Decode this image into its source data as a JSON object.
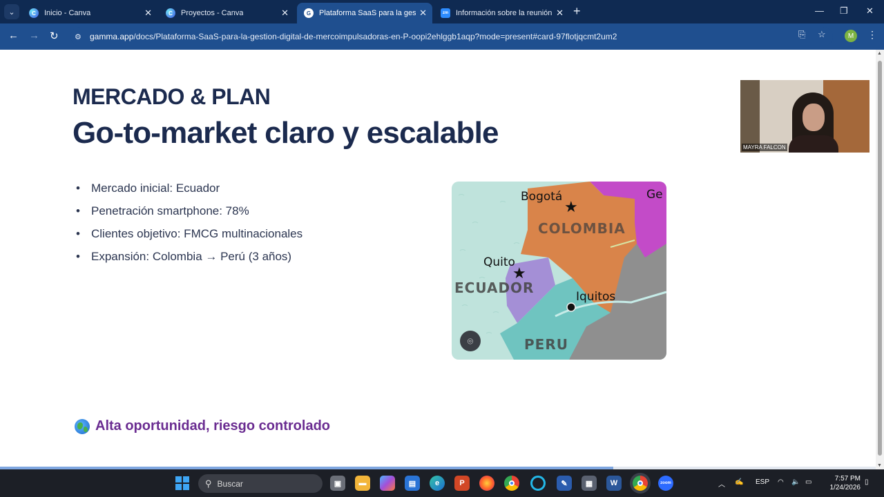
{
  "browser": {
    "tabs": [
      {
        "title": "Inicio - Canva",
        "icon": "canva-icon"
      },
      {
        "title": "Proyectos - Canva",
        "icon": "canva-icon"
      },
      {
        "title": "Plataforma SaaS para la gestión",
        "icon": "gamma-icon",
        "active": true
      },
      {
        "title": "Información sobre la reunión - ",
        "icon": "zoom-icon"
      }
    ],
    "url_host": "gamma.app",
    "url_path": "/docs/Plataforma-SaaS-para-la-gestion-digital-de-mercoimpulsadoras-en-P-oopi2ehlggb1aqp?mode=present#card-97flotjqcmt2um2",
    "profile_initial": "M"
  },
  "slide": {
    "eyebrow": "MERCADO & PLAN",
    "headline": "Go-to-market claro y escalable",
    "bullets": [
      "Mercado inicial: Ecuador",
      "Penetración smartphone: 78%",
      "Clientes objetivo: FMCG multinacionales",
      "Expansión: Colombia → Perú (3 años)"
    ],
    "callout": "Alta oportunidad, riesgo controlado",
    "map_labels": {
      "bogota": "Bogotá",
      "colombia": "COLOMBIA",
      "quito": "Quito",
      "ecuador": "ECUADOR",
      "iquitos": "Iquitos",
      "peru": "PERU",
      "ge": "Ge"
    },
    "progress": 0.7
  },
  "video": {
    "participant_name": "MAYRA FALCON"
  },
  "taskbar": {
    "search_label": "Buscar",
    "language": "ESP",
    "time": "7:57 PM",
    "date": "1/24/2026"
  },
  "colors": {
    "title": "#1b2a4e",
    "callout": "#6a2c91",
    "colombia": "#d9844a",
    "ecuador": "#a48fd6",
    "peru": "#6fc4c0",
    "ocean": "#bfe3dc",
    "brazil": "#8f8f8f",
    "venezuela": "#c34bc8"
  }
}
